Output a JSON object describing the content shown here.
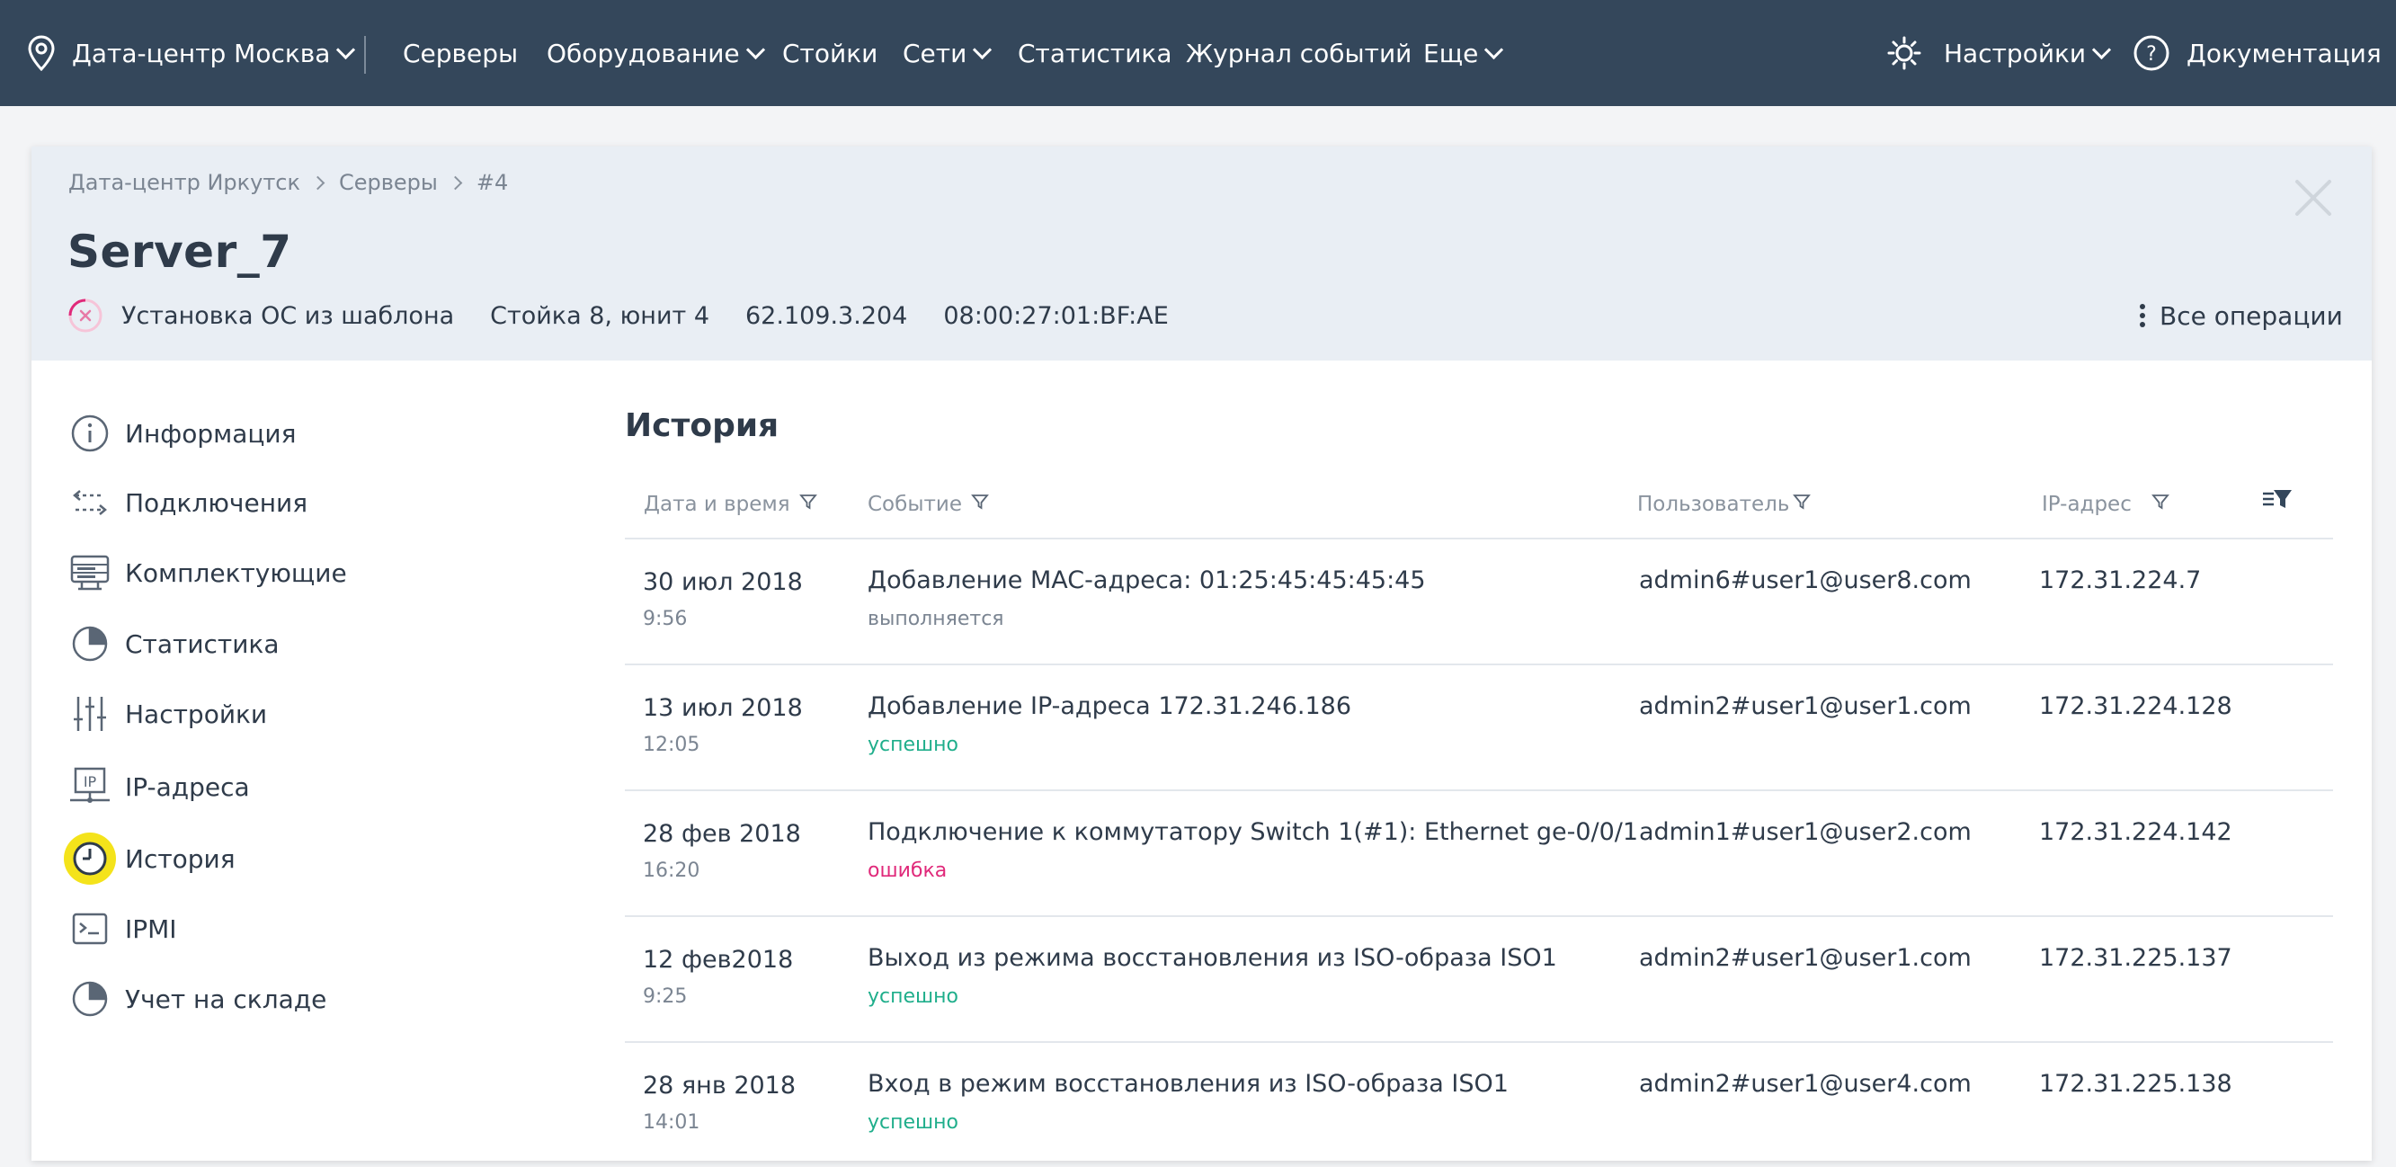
{
  "topnav": {
    "datacenter": "Дата-центр Москва",
    "items": [
      {
        "label": "Серверы"
      },
      {
        "label": "Оборудование"
      },
      {
        "label": "Стойки"
      },
      {
        "label": "Сети"
      },
      {
        "label": "Статистика"
      },
      {
        "label": "Журнал событий"
      },
      {
        "label": "Еще"
      }
    ],
    "settings": "Настройки",
    "docs": "Документация"
  },
  "header": {
    "breadcrumb": [
      "Дата-центр Иркутск",
      "Серверы",
      "#4"
    ],
    "title": "Server_7",
    "status_text": "Установка ОС из шаблона",
    "rack": "Стойка 8, юнит 4",
    "ip": "62.109.3.204",
    "mac": "08:00:27:01:BF:AE",
    "all_operations": "Все операции"
  },
  "sidebar": {
    "items": [
      {
        "label": "Информация",
        "icon": "info-icon"
      },
      {
        "label": "Подключения",
        "icon": "connections-icon"
      },
      {
        "label": "Комплектующие",
        "icon": "components-icon"
      },
      {
        "label": "Статистика",
        "icon": "pie-chart-icon"
      },
      {
        "label": "Настройки",
        "icon": "sliders-icon"
      },
      {
        "label": "IP-адреса",
        "icon": "ip-icon"
      },
      {
        "label": "История",
        "icon": "clock-icon",
        "active": true
      },
      {
        "label": "IPMI",
        "icon": "terminal-icon"
      },
      {
        "label": "Учет на складе",
        "icon": "pie-chart-icon"
      }
    ]
  },
  "history": {
    "title": "История",
    "columns": {
      "datetime": "Дата и время",
      "event": "Событие",
      "user": "Пользователь",
      "ip": "IP-адрес"
    },
    "rows": [
      {
        "date": "30 июл 2018",
        "time": "9:56",
        "event": "Добавление MAC-адреса: 01:25:45:45:45:45",
        "status": "выполняется",
        "user": "admin6#user1@user8.com",
        "ip": "172.31.224.7"
      },
      {
        "date": "13 июл 2018",
        "time": "12:05",
        "event": "Добавление IP-адреса 172.31.246.186",
        "status": "успешно",
        "user": "admin2#user1@user1.com",
        "ip": "172.31.224.128"
      },
      {
        "date": "28 фев 2018",
        "time": "16:20",
        "event": "Подключение к коммутатору Switch 1(#1): Ethernet ge-0/0/1",
        "status": "ошибка",
        "user": "admin1#user1@user2.com",
        "ip": "172.31.224.142"
      },
      {
        "date": "12 фев2018",
        "time": "9:25",
        "event": "Выход из режима восстановления из ISO-образа ISO1",
        "status": "успешно",
        "user": "admin2#user1@user1.com",
        "ip": "172.31.225.137"
      },
      {
        "date": "28 янв 2018",
        "time": "14:01",
        "event": "Вход в режим восстановления из ISO-образа ISO1",
        "status": "успешно",
        "user": "admin2#user1@user4.com",
        "ip": "172.31.225.138"
      }
    ]
  },
  "colors": {
    "navbar": "#34475b",
    "header_bg": "#e9eef4",
    "success": "#1fae8b",
    "error": "#e0297a",
    "pending": "#7b8592",
    "active_highlight": "#f4e31b"
  }
}
